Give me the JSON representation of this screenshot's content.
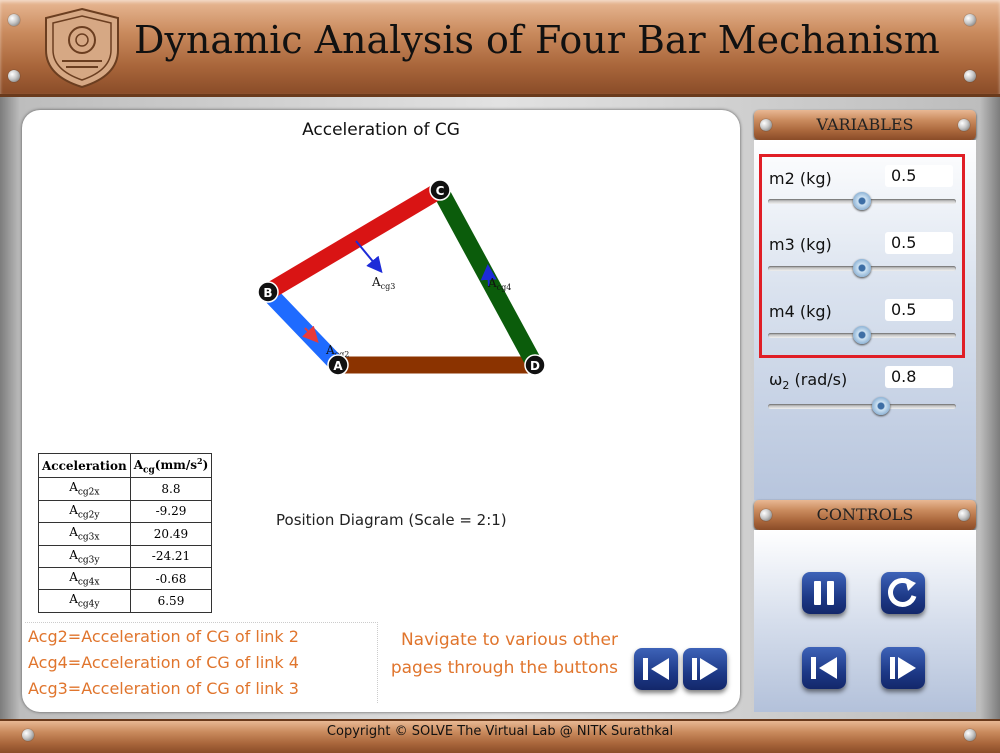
{
  "header": {
    "title": "Dynamic Analysis of Four Bar Mechanism"
  },
  "main": {
    "title": "Acceleration of CG",
    "diagram": {
      "points": [
        "A",
        "B",
        "C",
        "D"
      ],
      "vectors": [
        {
          "main": "A",
          "sub": "cg2"
        },
        {
          "main": "A",
          "sub": "cg3"
        },
        {
          "main": "A",
          "sub": "cg4"
        }
      ]
    },
    "table": {
      "headers": [
        "Acceleration",
        "Acg(mm/s2)"
      ],
      "rows": [
        {
          "main": "A",
          "sub": "cg2x",
          "value": "8.8"
        },
        {
          "main": "A",
          "sub": "cg2y",
          "value": "-9.29"
        },
        {
          "main": "A",
          "sub": "cg3x",
          "value": "20.49"
        },
        {
          "main": "A",
          "sub": "cg3y",
          "value": "-24.21"
        },
        {
          "main": "A",
          "sub": "cg4x",
          "value": "-0.68"
        },
        {
          "main": "A",
          "sub": "cg4y",
          "value": "6.59"
        }
      ]
    },
    "position_caption": "Position Diagram (Scale = 2:1)",
    "legend": [
      "Acg2=Acceleration of CG of link 2",
      "Acg4=Acceleration of CG of link 4",
      "Acg3=Acceleration of CG of link 3"
    ],
    "nav_hint": "Navigate to various other pages through the buttons"
  },
  "variables": {
    "heading": "VARIABLES",
    "items": [
      {
        "label": "m2 (kg)",
        "value": "0.5",
        "slider_fraction": 0.5
      },
      {
        "label": "m3 (kg)",
        "value": "0.5",
        "slider_fraction": 0.5
      },
      {
        "label": "m4 (kg)",
        "value": "0.5",
        "slider_fraction": 0.5
      },
      {
        "label_main": "ω",
        "label_sub": "2",
        "label_rest": " (rad/s)",
        "value": "0.8",
        "slider_fraction": 0.6
      }
    ]
  },
  "controls": {
    "heading": "CONTROLS"
  },
  "footer": {
    "copyright": "Copyright © SOLVE The Virtual Lab @ NITK Surathkal"
  },
  "colors": {
    "link2": "#1f6bff",
    "link3": "#d91414",
    "link4": "#0b5c0b",
    "link1": "#8b3300",
    "vector": "#1d2bd8",
    "highlight": "#e01e26",
    "note_text": "#e0752d"
  }
}
